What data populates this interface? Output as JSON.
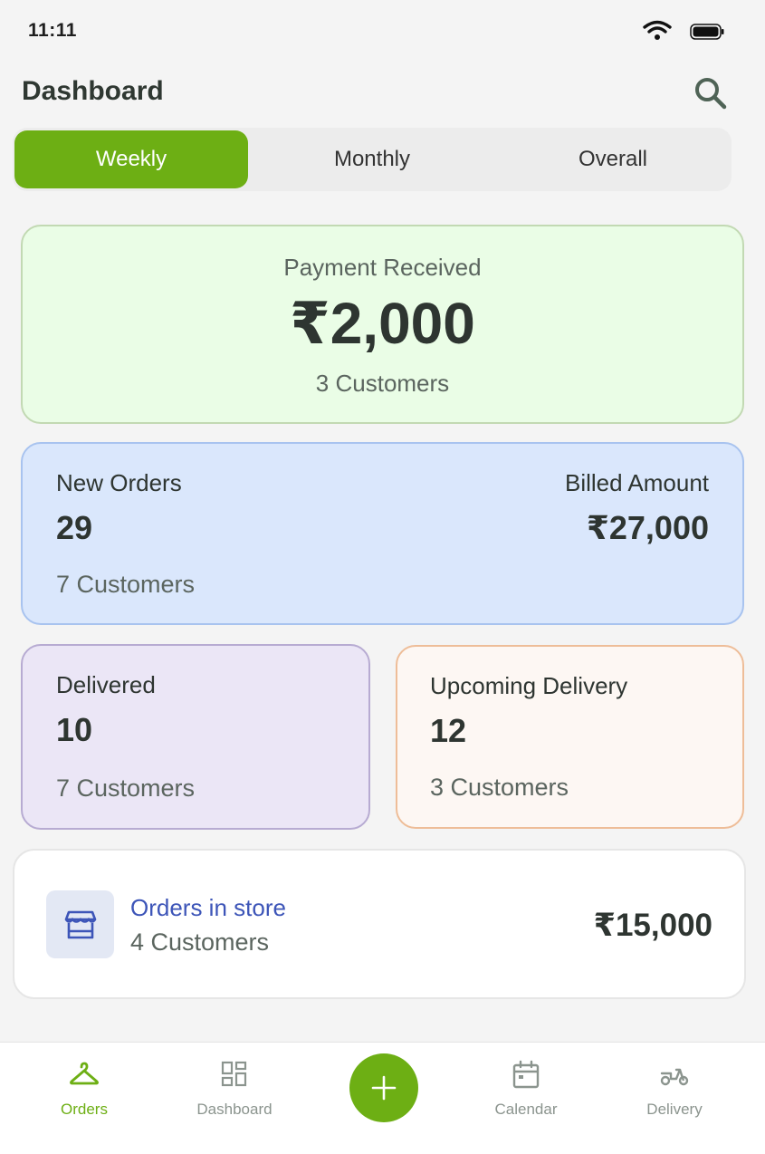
{
  "status_bar": {
    "time": "11:11"
  },
  "header": {
    "title": "Dashboard"
  },
  "tabs": [
    {
      "label": "Weekly",
      "active": true
    },
    {
      "label": "Monthly",
      "active": false
    },
    {
      "label": "Overall",
      "active": false
    }
  ],
  "payment": {
    "label": "Payment Received",
    "amount": "₹2,000",
    "customers": "3 Customers"
  },
  "orders": {
    "label": "New Orders",
    "count": "29",
    "customers": "7 Customers",
    "billed_label": "Billed Amount",
    "billed_amount": "₹27,000"
  },
  "delivered": {
    "label": "Delivered",
    "count": "10",
    "customers": "7 Customers"
  },
  "upcoming": {
    "label": "Upcoming Delivery",
    "count": "12",
    "customers": "3 Customers"
  },
  "store": {
    "title": "Orders in store",
    "customers": "4 Customers",
    "amount": "₹15,000",
    "icon": "store-icon"
  },
  "bottom_nav": {
    "items": [
      {
        "label": "Orders",
        "icon": "hanger-icon",
        "active": true
      },
      {
        "label": "Dashboard",
        "icon": "dashboard-icon",
        "active": false
      },
      {
        "label": "Calendar",
        "icon": "calendar-icon",
        "active": false
      },
      {
        "label": "Delivery",
        "icon": "scooter-icon",
        "active": false
      }
    ],
    "fab_icon": "plus-icon"
  },
  "colors": {
    "accent": "#6daf14",
    "payment_bg": "#eafde6",
    "orders_bg": "#dae7fc",
    "delivered_bg": "#ebe6f6",
    "upcoming_bg": "#fdf7f3",
    "store_title": "#3d55b8"
  }
}
